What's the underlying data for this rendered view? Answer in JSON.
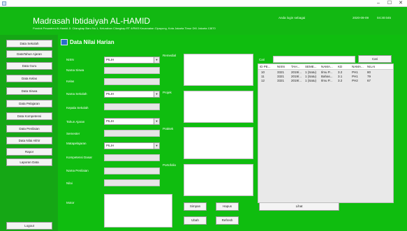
{
  "window": {
    "minimize": "–",
    "maximize": "☐",
    "close": "✕"
  },
  "header": {
    "title": "Madrasah Ibtidaiyah AL-HAMID",
    "address": "Pondok Pesantren Al-Hamid Jl. Cilangkap Baru No.1, Kelurahan Cilangkap RT 4/RW3 Kecamatan Cipayung, Kota Jakarta Timur DKI Jakarta 13870",
    "login_status": "Anda login sebagai",
    "date": "2020-09-09",
    "time": "04:30:045"
  },
  "sidebar": {
    "items": [
      {
        "label": "Data Sekolah"
      },
      {
        "label": "DataTahun Ajaran"
      },
      {
        "label": "Data Guru"
      },
      {
        "label": "Data Kelas"
      },
      {
        "label": "Data Siswa"
      },
      {
        "label": "Data Pelajaran"
      },
      {
        "label": "Data Kompetensi"
      },
      {
        "label": "Data Penilaian"
      },
      {
        "label": "Data Nilai Akhir"
      },
      {
        "label": "Rapor"
      },
      {
        "label": "Laporan Data"
      }
    ],
    "logout": "Logout"
  },
  "panel": {
    "title": "Data Nilai Harian"
  },
  "form": {
    "nisn": "NISN",
    "nama_siswa": "Nama Siswa",
    "kelas": "Kelas",
    "nama_sekolah": "Nama Sekolah",
    "kepala_sekolah": "Kepala Sekolah",
    "tahun_ajaran": "Tahun Ajaran",
    "semester": "Semester",
    "matapelajaran": "Matapelajaran",
    "kompetensi_dasar": "Kompetensi Dasar",
    "nama_penilaian": "Nama Penilaian",
    "nilai": "Nilai",
    "motor": "Motor",
    "select_placeholder": "PILIH"
  },
  "notes": {
    "remedial": "Remedial",
    "projek": "Projek",
    "praktek": "Praktek",
    "portofolio": "Portofolio"
  },
  "buttons": {
    "simpan": "Simpan",
    "hapus": "Hapus",
    "lihat": "Lihat",
    "ubah": "Ubah",
    "refresh": "Refresh"
  },
  "search": {
    "label": "Cari",
    "button": "Cari"
  },
  "table": {
    "columns": [
      "ID PE...",
      "NISN",
      "TAH...",
      "SEME...",
      "NAMA...",
      "KD",
      "NAMA...",
      "NILAI"
    ],
    "rows": [
      [
        "10",
        "3321",
        "2019/...",
        "1 (Satu)",
        "Ilmu P...",
        "3.2",
        "PH1",
        "80"
      ],
      [
        "11",
        "3321",
        "2019/...",
        "1 (Satu)",
        "Bahas...",
        "3.1",
        "PH1",
        "79"
      ],
      [
        "12",
        "3321",
        "2019/...",
        "1 (Satu)",
        "Ilmu P...",
        "3.2",
        "PH2",
        "67"
      ]
    ]
  },
  "colors": {
    "header_green": "#12b812",
    "sidebar_green": "#15a715",
    "panel_green": "#0fbd0f"
  }
}
